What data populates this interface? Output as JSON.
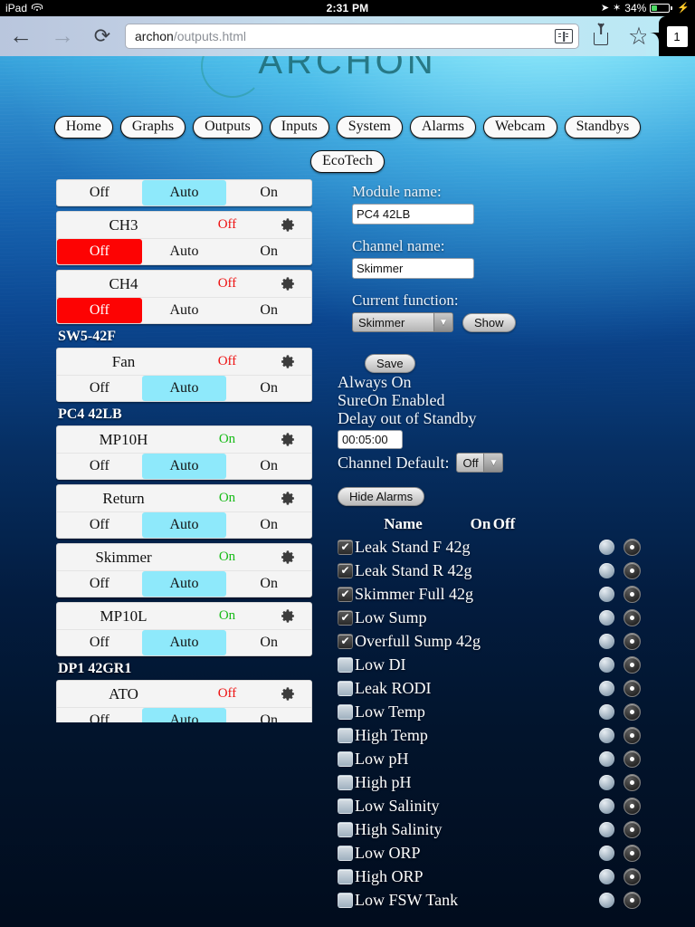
{
  "statusbar": {
    "device": "iPad",
    "wifi_icon": "wifi-icon",
    "time": "2:31 PM",
    "location_icon": "location-arrow-icon",
    "bluetooth_icon": "bluetooth-icon",
    "battery_percent": "34%",
    "battery_level": 34,
    "charging_icon": "lightning-bolt-icon"
  },
  "toolbar": {
    "back_icon": "back-arrow-icon",
    "forward_icon": "forward-arrow-icon",
    "reload_icon": "reload-icon",
    "url_host": "archon",
    "url_path": "/outputs.html",
    "url_full": "archon/outputs.html",
    "reader_icon": "reader-view-icon",
    "share_icon": "share-icon",
    "bookmark_icon": "star-bookmark-icon",
    "tab_count": "1"
  },
  "header": {
    "logo_text": "ARCHON",
    "logo_ring_icon": "archon-ring-icon"
  },
  "nav": {
    "items": [
      {
        "label": "Home"
      },
      {
        "label": "Graphs"
      },
      {
        "label": "Outputs"
      },
      {
        "label": "Inputs"
      },
      {
        "label": "System"
      },
      {
        "label": "Alarms"
      },
      {
        "label": "Webcam"
      },
      {
        "label": "Standbys"
      }
    ],
    "secondary": [
      {
        "label": "EcoTech"
      }
    ]
  },
  "channels": {
    "seg_labels": {
      "off": "Off",
      "auto": "Auto",
      "on": "On"
    },
    "gear_icon": "gear-icon",
    "entries": [
      {
        "kind": "channel",
        "name": "",
        "state": "",
        "state_class": "",
        "selected": "auto",
        "partial": true
      },
      {
        "kind": "channel",
        "name": "CH3",
        "state": "Off",
        "state_class": "off",
        "selected": "off"
      },
      {
        "kind": "channel",
        "name": "CH4",
        "state": "Off",
        "state_class": "off",
        "selected": "off"
      },
      {
        "kind": "group",
        "label": "SW5-42F"
      },
      {
        "kind": "channel",
        "name": "Fan",
        "state": "Off",
        "state_class": "off",
        "selected": "auto"
      },
      {
        "kind": "group",
        "label": "PC4 42LB"
      },
      {
        "kind": "channel",
        "name": "MP10H",
        "state": "On",
        "state_class": "on",
        "selected": "auto"
      },
      {
        "kind": "channel",
        "name": "Return",
        "state": "On",
        "state_class": "on",
        "selected": "auto"
      },
      {
        "kind": "channel",
        "name": "Skimmer",
        "state": "On",
        "state_class": "on",
        "selected": "auto"
      },
      {
        "kind": "channel",
        "name": "MP10L",
        "state": "On",
        "state_class": "on",
        "selected": "auto"
      },
      {
        "kind": "group",
        "label": "DP1 42GR1"
      },
      {
        "kind": "channel",
        "name": "ATO",
        "state": "Off",
        "state_class": "off",
        "selected": "auto"
      }
    ]
  },
  "detail": {
    "module_name_label": "Module name:",
    "module_name_value": "PC4 42LB",
    "channel_name_label": "Channel name:",
    "channel_name_value": "Skimmer",
    "current_function_label": "Current function:",
    "current_function_value": "Skimmer",
    "show_button": "Show",
    "save_button": "Save",
    "always_on": "Always On",
    "sure_on": "SureOn Enabled",
    "delay_out_of_standby": "Delay out of Standby",
    "delay_value": "00:05:00",
    "channel_default_label": "Channel Default:",
    "channel_default_value": "Off",
    "dropdown_icon": "chevron-down-icon"
  },
  "alarms": {
    "toggle_button": "Hide Alarms",
    "columns": {
      "name": "Name",
      "on": "On",
      "off": "Off"
    },
    "rows": [
      {
        "name": "Leak Stand F 42g",
        "enabled": true,
        "state": "off"
      },
      {
        "name": "Leak Stand R 42g",
        "enabled": true,
        "state": "off"
      },
      {
        "name": "Skimmer Full 42g",
        "enabled": true,
        "state": "off"
      },
      {
        "name": "Low Sump",
        "enabled": true,
        "state": "off"
      },
      {
        "name": "Overfull Sump 42g",
        "enabled": true,
        "state": "off"
      },
      {
        "name": "Low DI",
        "enabled": false,
        "state": "off"
      },
      {
        "name": "Leak RODI",
        "enabled": false,
        "state": "off"
      },
      {
        "name": "Low Temp",
        "enabled": false,
        "state": "off"
      },
      {
        "name": "High Temp",
        "enabled": false,
        "state": "off"
      },
      {
        "name": "Low pH",
        "enabled": false,
        "state": "off"
      },
      {
        "name": "High pH",
        "enabled": false,
        "state": "off"
      },
      {
        "name": "Low Salinity",
        "enabled": false,
        "state": "off"
      },
      {
        "name": "High Salinity",
        "enabled": false,
        "state": "off"
      },
      {
        "name": "Low ORP",
        "enabled": false,
        "state": "off"
      },
      {
        "name": "High ORP",
        "enabled": false,
        "state": "off"
      },
      {
        "name": "Low FSW Tank",
        "enabled": false,
        "state": "off"
      }
    ]
  },
  "colors": {
    "auto_selected": "#8ee9fb",
    "off_selected": "#fd0303",
    "state_on": "#19bb19",
    "state_off": "#ee1111",
    "battery_green": "#4cd964",
    "logo_teal": "#1d6a74"
  }
}
